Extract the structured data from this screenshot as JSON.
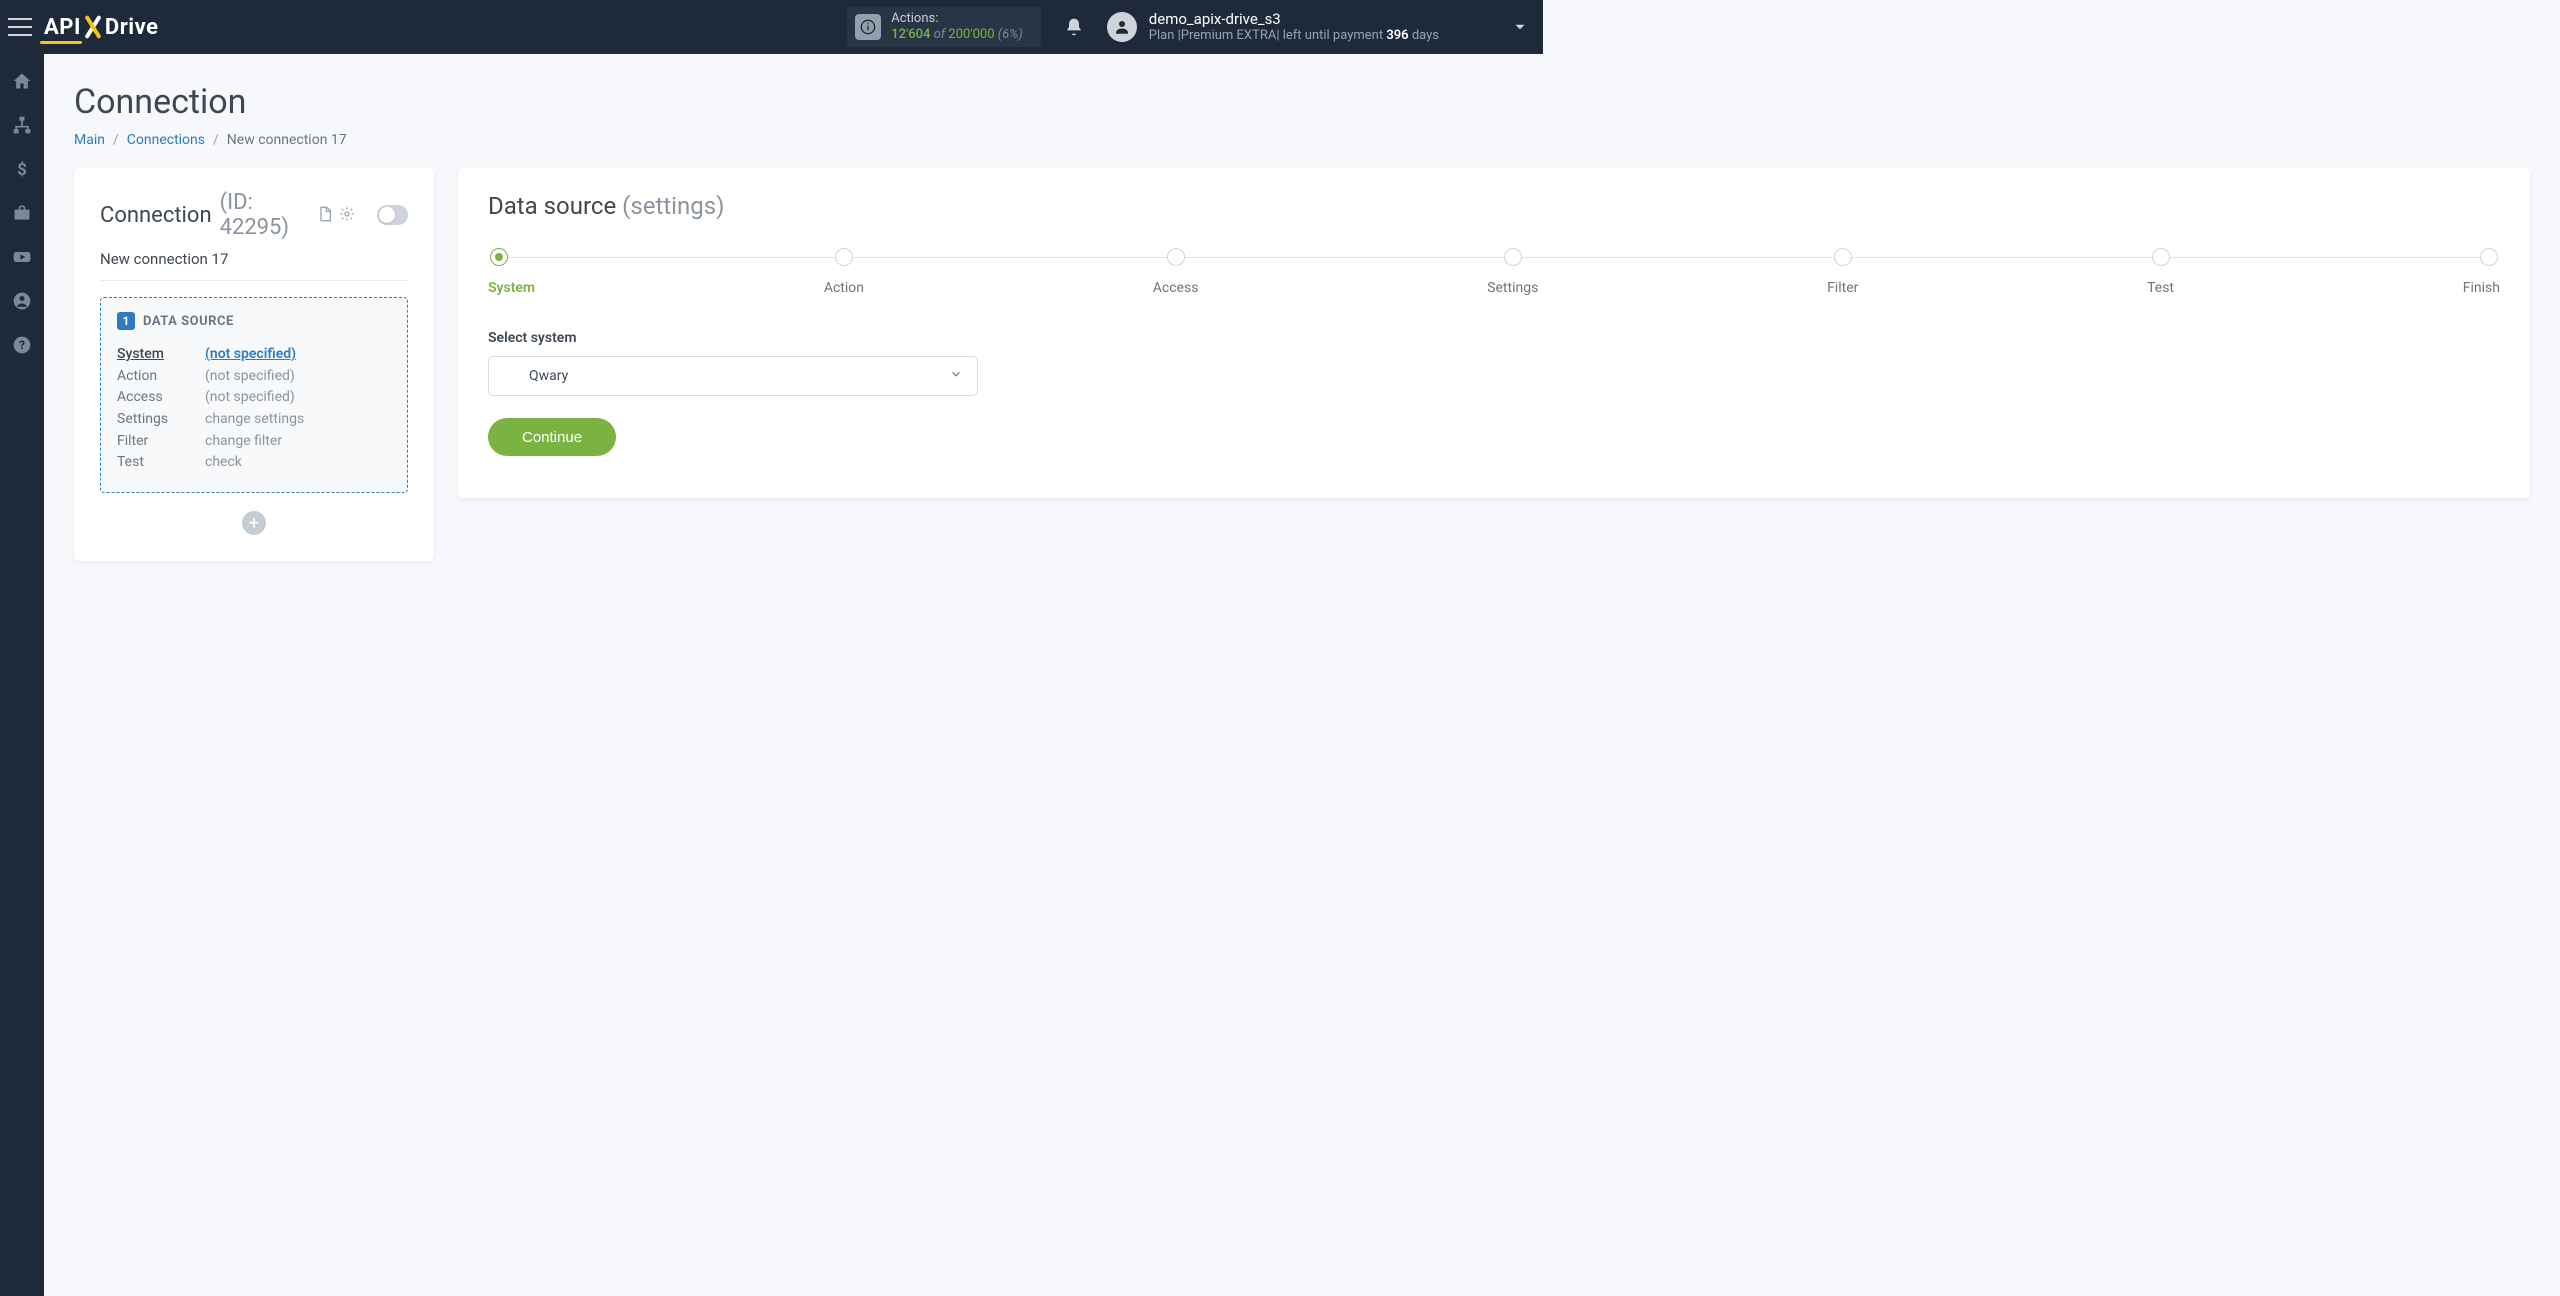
{
  "header": {
    "actions_label": "Actions:",
    "actions_used": "12'604",
    "actions_of": "of",
    "actions_total": "200'000",
    "actions_pct": "(6%)",
    "username": "demo_apix-drive_s3",
    "plan_prefix": "Plan |",
    "plan_name": "Premium EXTRA",
    "plan_mid": "| left until payment",
    "plan_days_num": "396",
    "plan_days_word": "days"
  },
  "page": {
    "title": "Connection"
  },
  "breadcrumb": {
    "a": "Main",
    "b": "Connections",
    "current": "New connection 17"
  },
  "left_card": {
    "head_a": "Connection",
    "head_b": "(ID: 42295)",
    "conn_name": "New connection 17",
    "ds_badge": "1",
    "ds_title": "DATA SOURCE",
    "rows": [
      {
        "k": "System",
        "v": "(not specified)",
        "active": true
      },
      {
        "k": "Action",
        "v": "(not specified)"
      },
      {
        "k": "Access",
        "v": "(not specified)"
      },
      {
        "k": "Settings",
        "v": "change settings"
      },
      {
        "k": "Filter",
        "v": "change filter"
      },
      {
        "k": "Test",
        "v": "check"
      }
    ]
  },
  "right_card": {
    "title_a": "Data source",
    "title_b": "(settings)",
    "form_label": "Select system",
    "select_value": "Qwary",
    "continue": "Continue",
    "steps": [
      "System",
      "Action",
      "Access",
      "Settings",
      "Filter",
      "Test",
      "Finish"
    ],
    "active_step_index": 0
  }
}
